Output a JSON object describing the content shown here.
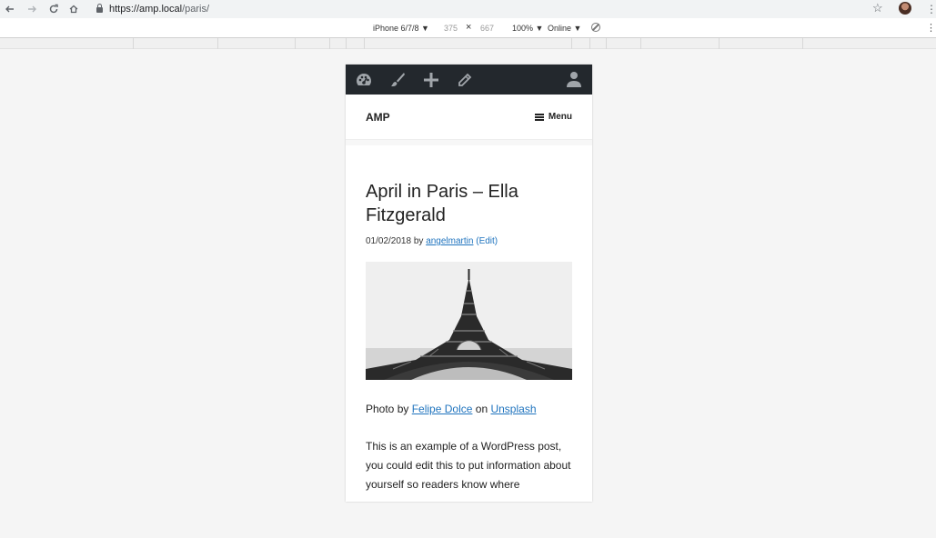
{
  "browser": {
    "url_scheme_host": "https://amp.local",
    "url_path": "/paris/",
    "back_icon": "arrow-left-icon",
    "forward_icon": "arrow-right-icon",
    "reload_icon": "reload-icon",
    "home_icon": "home-icon"
  },
  "device_toolbar": {
    "device": "iPhone 6/7/8 ▼",
    "width": "375",
    "times": "×",
    "height": "667",
    "zoom": "100% ▼",
    "network": "Online ▼"
  },
  "admin_bar": {
    "bg_color": "#23282d",
    "icons": [
      "dashboard-icon",
      "customize-brush-icon",
      "new-content-icon",
      "edit-pencil-icon"
    ],
    "user_icon": "user-icon"
  },
  "site": {
    "title": "AMP",
    "menu_label": "Menu"
  },
  "post": {
    "title": "April in Paris – Ella Fitzgerald",
    "date": "01/02/2018",
    "by": "by",
    "author": "angelmartin",
    "edit": "(Edit)",
    "caption_prefix": "Photo by",
    "photographer": "Felipe Dolce",
    "caption_on": "on",
    "source": "Unsplash",
    "body": "This is an example of a WordPress post, you could edit this to put information about yourself so readers know where"
  },
  "colors": {
    "link": "#1e73be",
    "text": "#222222"
  }
}
